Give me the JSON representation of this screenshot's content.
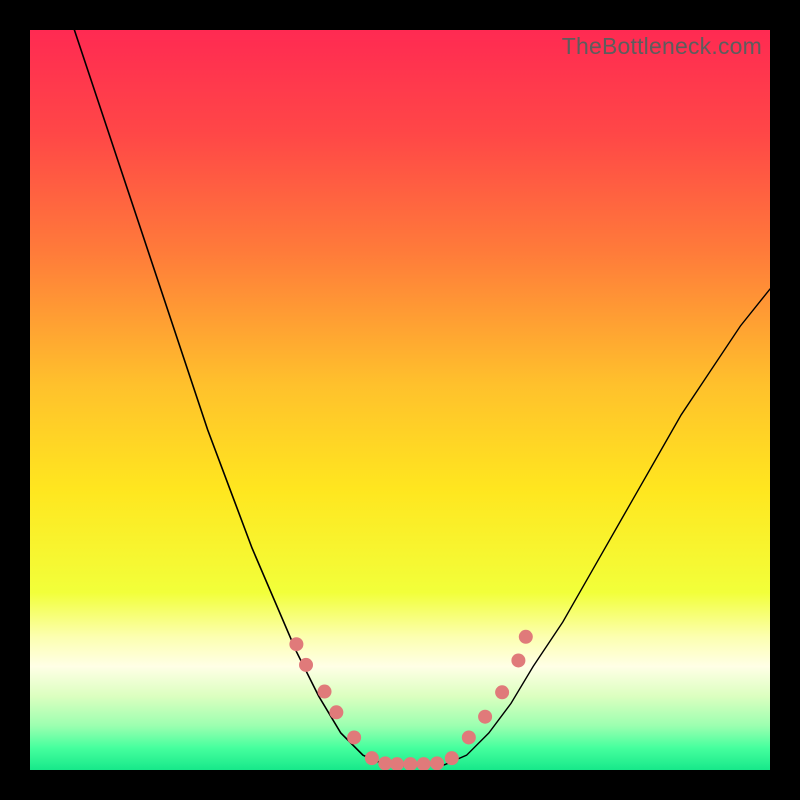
{
  "watermark": "TheBottleneck.com",
  "chart_data": {
    "type": "line",
    "title": "",
    "xlabel": "",
    "ylabel": "",
    "xlim": [
      0,
      100
    ],
    "ylim": [
      0,
      100
    ],
    "grid": false,
    "legend": false,
    "background_gradient_stops": [
      {
        "offset": 0,
        "color": "#ff2a52"
      },
      {
        "offset": 0.14,
        "color": "#ff4747"
      },
      {
        "offset": 0.3,
        "color": "#ff7b3a"
      },
      {
        "offset": 0.48,
        "color": "#ffc12c"
      },
      {
        "offset": 0.62,
        "color": "#ffe61f"
      },
      {
        "offset": 0.76,
        "color": "#f2ff3a"
      },
      {
        "offset": 0.82,
        "color": "#fcffb0"
      },
      {
        "offset": 0.86,
        "color": "#ffffe6"
      },
      {
        "offset": 0.9,
        "color": "#dcffc0"
      },
      {
        "offset": 0.94,
        "color": "#9cffb0"
      },
      {
        "offset": 0.97,
        "color": "#46ff9e"
      },
      {
        "offset": 1.0,
        "color": "#17e88a"
      }
    ],
    "series": [
      {
        "name": "bottleneck-curve-left",
        "color": "#000000",
        "width": 1.6,
        "points": [
          {
            "x": 6,
            "y": 100
          },
          {
            "x": 9,
            "y": 91
          },
          {
            "x": 12,
            "y": 82
          },
          {
            "x": 15,
            "y": 73
          },
          {
            "x": 18,
            "y": 64
          },
          {
            "x": 21,
            "y": 55
          },
          {
            "x": 24,
            "y": 46
          },
          {
            "x": 27,
            "y": 38
          },
          {
            "x": 30,
            "y": 30
          },
          {
            "x": 33,
            "y": 23
          },
          {
            "x": 36,
            "y": 16
          },
          {
            "x": 39,
            "y": 10
          },
          {
            "x": 42,
            "y": 5
          },
          {
            "x": 45,
            "y": 2
          },
          {
            "x": 48,
            "y": 0.7
          }
        ]
      },
      {
        "name": "bottleneck-curve-flat",
        "color": "#000000",
        "width": 1.4,
        "points": [
          {
            "x": 48,
            "y": 0.7
          },
          {
            "x": 50,
            "y": 0.6
          },
          {
            "x": 53,
            "y": 0.6
          },
          {
            "x": 56,
            "y": 0.7
          }
        ]
      },
      {
        "name": "bottleneck-curve-right",
        "color": "#000000",
        "width": 1.4,
        "points": [
          {
            "x": 56,
            "y": 0.7
          },
          {
            "x": 59,
            "y": 2
          },
          {
            "x": 62,
            "y": 5
          },
          {
            "x": 65,
            "y": 9
          },
          {
            "x": 68,
            "y": 14
          },
          {
            "x": 72,
            "y": 20
          },
          {
            "x": 76,
            "y": 27
          },
          {
            "x": 80,
            "y": 34
          },
          {
            "x": 84,
            "y": 41
          },
          {
            "x": 88,
            "y": 48
          },
          {
            "x": 92,
            "y": 54
          },
          {
            "x": 96,
            "y": 60
          },
          {
            "x": 100,
            "y": 65
          }
        ]
      }
    ],
    "markers": {
      "name": "region-markers",
      "color": "#e07a7a",
      "radius": 7,
      "points": [
        {
          "x": 36.0,
          "y": 17.0
        },
        {
          "x": 37.3,
          "y": 14.2
        },
        {
          "x": 39.8,
          "y": 10.6
        },
        {
          "x": 41.4,
          "y": 7.8
        },
        {
          "x": 43.8,
          "y": 4.4
        },
        {
          "x": 46.2,
          "y": 1.6
        },
        {
          "x": 48.0,
          "y": 0.9
        },
        {
          "x": 49.6,
          "y": 0.8
        },
        {
          "x": 51.4,
          "y": 0.8
        },
        {
          "x": 53.2,
          "y": 0.8
        },
        {
          "x": 55.0,
          "y": 0.9
        },
        {
          "x": 57.0,
          "y": 1.6
        },
        {
          "x": 59.3,
          "y": 4.4
        },
        {
          "x": 61.5,
          "y": 7.2
        },
        {
          "x": 63.8,
          "y": 10.5
        },
        {
          "x": 66.0,
          "y": 14.8
        },
        {
          "x": 67.0,
          "y": 18.0
        }
      ]
    }
  }
}
